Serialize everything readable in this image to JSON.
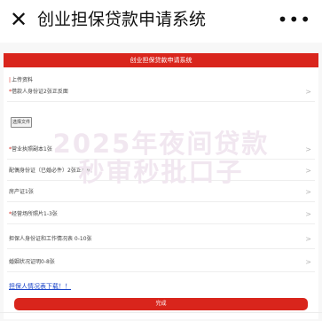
{
  "header": {
    "close_icon": "close-icon",
    "title": "创业担保贷款申请系统",
    "more_icon": "more-icon"
  },
  "form": {
    "banner": "创业担保贷款申请系统",
    "section_marker": "|",
    "section_title": "上传资料",
    "rows": [
      {
        "required": "*",
        "label": "借款人身份证2张正反面"
      },
      {
        "required": "*",
        "label": "营业执照副本1张"
      },
      {
        "required": "",
        "label": "配偶身份证（已婚必件）2张正反面"
      },
      {
        "required": "",
        "label": "房产证1张"
      },
      {
        "required": "*",
        "label": "经营场所照片1-3张"
      },
      {
        "required": "",
        "label": "担保人身份证和工作情况表 0-10张"
      },
      {
        "required": "",
        "label": "婚姻状况证明0-8张"
      }
    ],
    "file_button": "选择文件",
    "download_link": "担保人情况表下载！！",
    "submit": "完成"
  },
  "watermark": {
    "line1": "2025年夜间贷款",
    "line2": "秒审秒批口子"
  },
  "colors": {
    "accent": "#d9251c",
    "link": "#1a44c9"
  }
}
